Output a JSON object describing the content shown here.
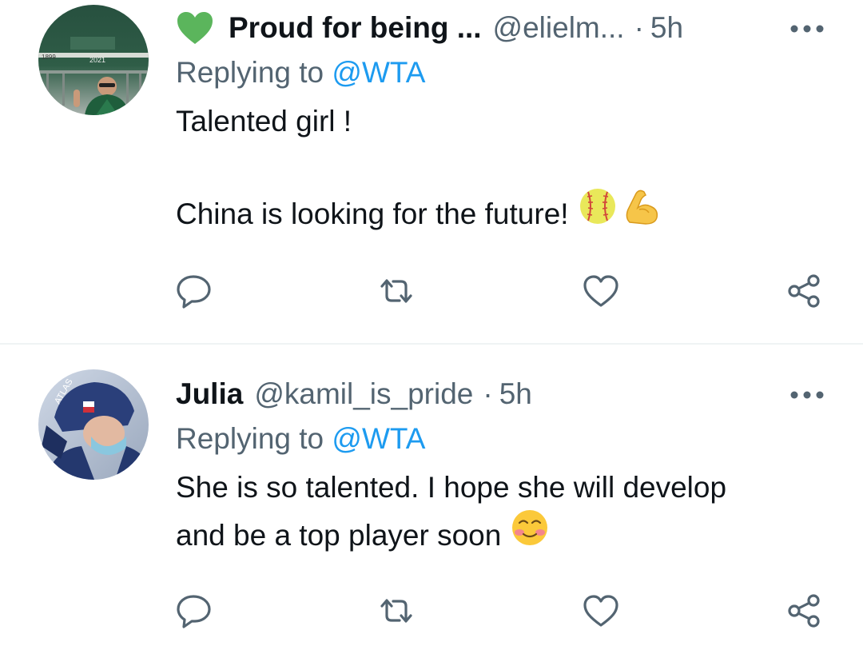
{
  "tweets": [
    {
      "display_name": "Proud for being ...",
      "name_badge_icon": "green-heart-icon",
      "handle": "@elielm...",
      "separator": "·",
      "time": "5h",
      "replying_prefix": "Replying to",
      "replying_mention": "@WTA",
      "text_lines": [
        "Talented girl !",
        "",
        "China is looking for the future!"
      ],
      "emojis": [
        "softball-emoji",
        "flexed-biceps-emoji"
      ],
      "actions": [
        "reply-icon",
        "retweet-icon",
        "like-icon",
        "share-icon"
      ]
    },
    {
      "display_name": "Julia",
      "handle": "@kamil_is_pride",
      "separator": "·",
      "time": "5h",
      "replying_prefix": "Replying to",
      "replying_mention": "@WTA",
      "text_lines": [
        "She is so talented. I hope she will develop",
        "and be a top player soon"
      ],
      "emojis": [
        "smiling-face-with-blush-emoji"
      ],
      "actions": [
        "reply-icon",
        "retweet-icon",
        "like-icon",
        "share-icon"
      ]
    }
  ],
  "colors": {
    "text_primary": "#0f1419",
    "text_secondary": "#536471",
    "link": "#1d9bf0",
    "divider": "#eff3f4",
    "heart_badge": "#5bb55c"
  }
}
